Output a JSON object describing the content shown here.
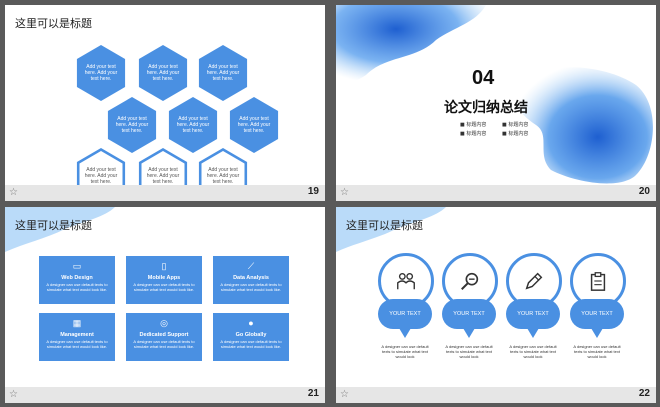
{
  "slides": [
    {
      "number": "19",
      "title": "这里可以是标题",
      "hexes": [
        {
          "text": "Add your text here. Add your text here."
        },
        {
          "text": "Add your text here. Add your text here."
        },
        {
          "text": "Add your text here. Add your text here."
        },
        {
          "text": "Add your text here. Add your text here."
        },
        {
          "text": "Add your text here. Add your text here."
        },
        {
          "text": "Add your text here. Add your text here."
        },
        {
          "text": "Add your text here. Add your text here."
        },
        {
          "text": "Add your text here. Add your text here."
        },
        {
          "text": "Add your text here. Add your text here."
        }
      ]
    },
    {
      "number": "20",
      "section_num": "04",
      "section_title": "论文归纳总结",
      "bullets": [
        "标题内容",
        "标题内容",
        "标题内容",
        "标题内容"
      ]
    },
    {
      "number": "21",
      "title": "这里可以是标题",
      "tiles": [
        {
          "heading": "Web Design",
          "icon": "monitor-icon",
          "text": "A designer can use default texts to simulate what text would look like."
        },
        {
          "heading": "Mobile Apps",
          "icon": "phone-icon",
          "text": "A designer can use default texts to simulate what text would look like."
        },
        {
          "heading": "Data Analysis",
          "icon": "chart-icon",
          "text": "A designer can use default texts to simulate what text would look like."
        },
        {
          "heading": "Management",
          "icon": "calendar-icon",
          "text": "A designer can use default texts to simulate what text would look like."
        },
        {
          "heading": "Dedicated Support",
          "icon": "lifebuoy-icon",
          "text": "A designer can use default texts to simulate what text would look like."
        },
        {
          "heading": "Go Globally",
          "icon": "globe-icon",
          "text": "A designer can use default texts to simulate what text would look like."
        }
      ]
    },
    {
      "number": "22",
      "title": "这里可以是标题",
      "bubbles": [
        {
          "label": "YOUR TEXT",
          "icon": "people-icon",
          "text": "A designer can use default texts to simulate what text would look"
        },
        {
          "label": "YOUR TEXT",
          "icon": "search-icon",
          "text": "A designer can use default texts to simulate what text would look"
        },
        {
          "label": "YOUR TEXT",
          "icon": "pen-icon",
          "text": "A designer can use default texts to simulate what text would look"
        },
        {
          "label": "YOUR TEXT",
          "icon": "clipboard-icon",
          "text": "A designer can use default texts to simulate what text would look"
        }
      ]
    }
  ],
  "colors": {
    "accent": "#4a90e2",
    "background": "#5a5a5a"
  }
}
